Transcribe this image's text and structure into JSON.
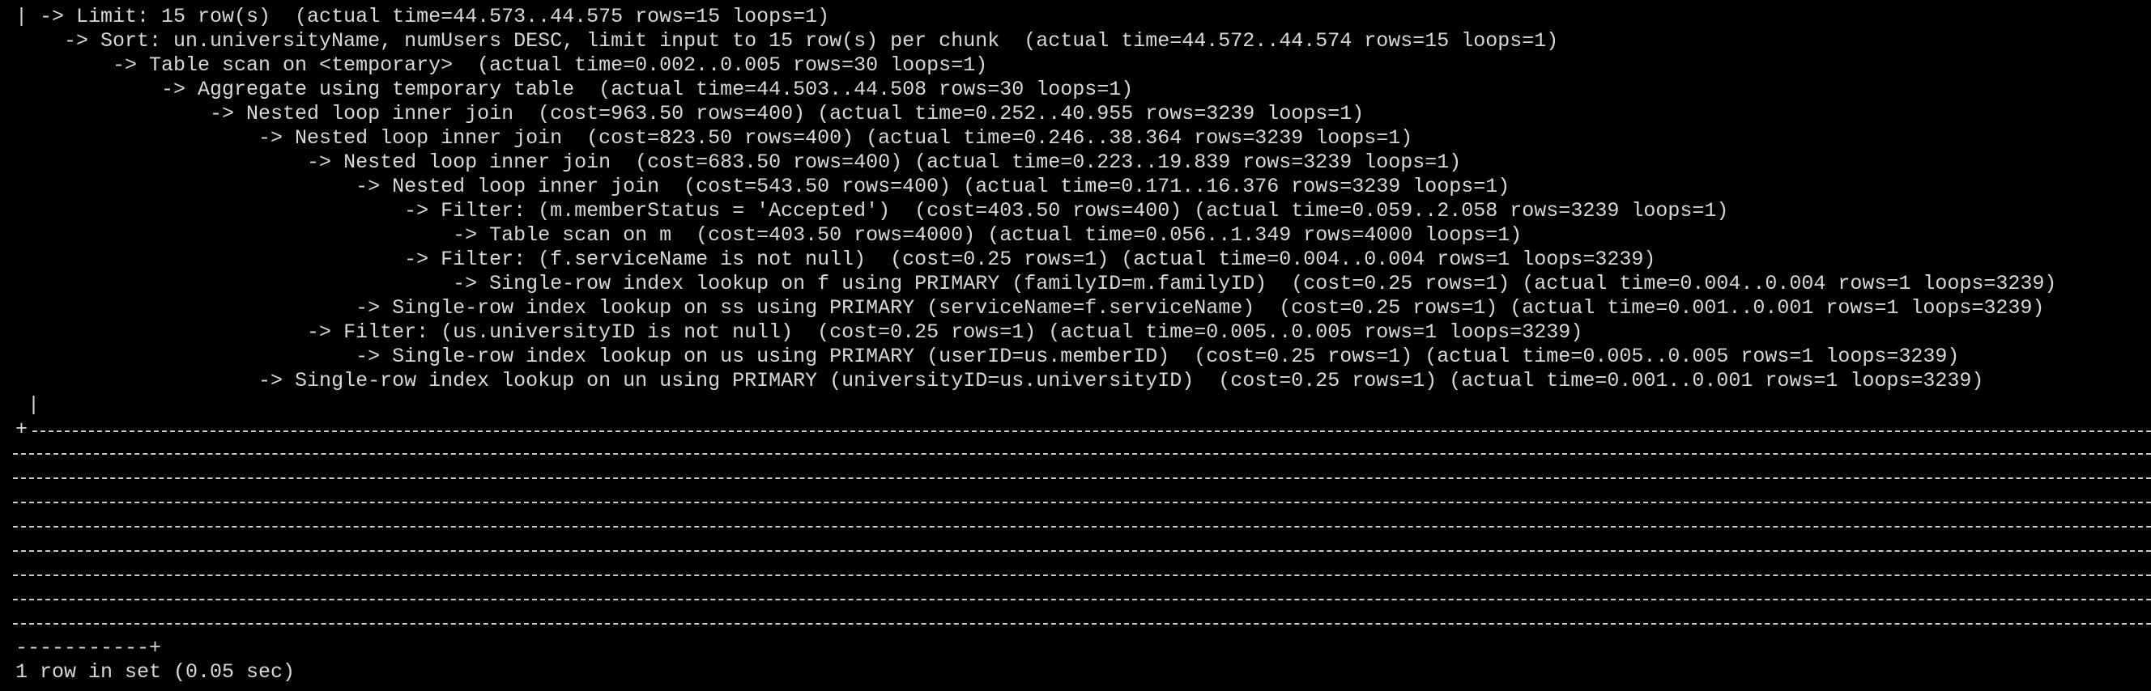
{
  "colors": {
    "background": "#000000",
    "text": "#d8d8d8",
    "rule": "#c9c9c9"
  },
  "plan": {
    "lines": [
      "| -> Limit: 15 row(s)  (actual time=44.573..44.575 rows=15 loops=1)",
      "    -> Sort: un.universityName, numUsers DESC, limit input to 15 row(s) per chunk  (actual time=44.572..44.574 rows=15 loops=1)",
      "        -> Table scan on <temporary>  (actual time=0.002..0.005 rows=30 loops=1)",
      "            -> Aggregate using temporary table  (actual time=44.503..44.508 rows=30 loops=1)",
      "                -> Nested loop inner join  (cost=963.50 rows=400) (actual time=0.252..40.955 rows=3239 loops=1)",
      "                    -> Nested loop inner join  (cost=823.50 rows=400) (actual time=0.246..38.364 rows=3239 loops=1)",
      "                        -> Nested loop inner join  (cost=683.50 rows=400) (actual time=0.223..19.839 rows=3239 loops=1)",
      "                            -> Nested loop inner join  (cost=543.50 rows=400) (actual time=0.171..16.376 rows=3239 loops=1)",
      "                                -> Filter: (m.memberStatus = 'Accepted')  (cost=403.50 rows=400) (actual time=0.059..2.058 rows=3239 loops=1)",
      "                                    -> Table scan on m  (cost=403.50 rows=4000) (actual time=0.056..1.349 rows=4000 loops=1)",
      "                                -> Filter: (f.serviceName is not null)  (cost=0.25 rows=1) (actual time=0.004..0.004 rows=1 loops=3239)",
      "                                    -> Single-row index lookup on f using PRIMARY (familyID=m.familyID)  (cost=0.25 rows=1) (actual time=0.004..0.004 rows=1 loops=3239)",
      "                            -> Single-row index lookup on ss using PRIMARY (serviceName=f.serviceName)  (cost=0.25 rows=1) (actual time=0.001..0.001 rows=1 loops=3239)",
      "                        -> Filter: (us.universityID is not null)  (cost=0.25 rows=1) (actual time=0.005..0.005 rows=1 loops=3239)",
      "                            -> Single-row index lookup on us using PRIMARY (userID=us.memberID)  (cost=0.25 rows=1) (actual time=0.005..0.005 rows=1 loops=3239)",
      "                    -> Single-row index lookup on un using PRIMARY (universityID=us.universityID)  (cost=0.25 rows=1) (actual time=0.001..0.001 rows=1 loops=3239)"
    ],
    "closing_bar": " |"
  },
  "table_border": {
    "corner_top": "+",
    "corner_bottom": "-----------+"
  },
  "result": {
    "summary": "1 row in set (0.05 sec)"
  }
}
